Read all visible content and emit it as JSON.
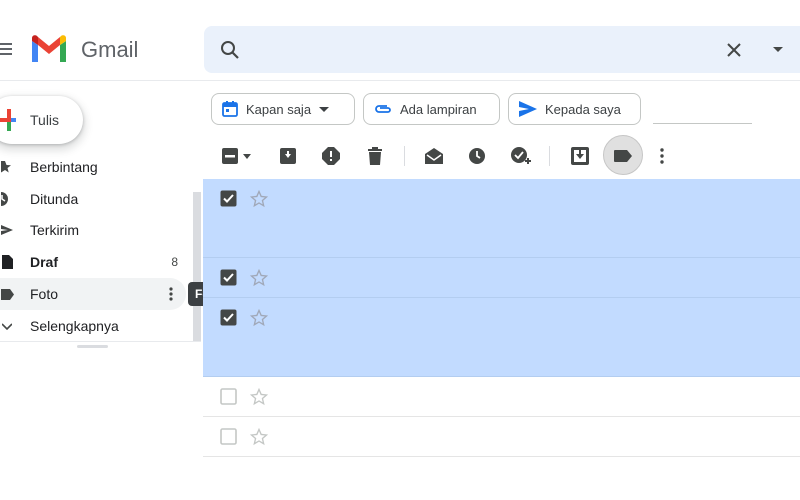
{
  "header": {
    "app_name": "Gmail",
    "search": {
      "value": "",
      "placeholder": ""
    },
    "icons": [
      "menu-icon",
      "gmail-logo",
      "search-icon",
      "close-icon",
      "dropdown-icon"
    ]
  },
  "compose": {
    "label": "Tulis"
  },
  "sidebar": {
    "items": [
      {
        "label": "Berbintang",
        "icon": "star-icon",
        "count": "",
        "bold": false,
        "active": false
      },
      {
        "label": "Ditunda",
        "icon": "clock-icon",
        "count": "",
        "bold": false,
        "active": false
      },
      {
        "label": "Terkirim",
        "icon": "send-icon",
        "count": "",
        "bold": false,
        "active": false
      },
      {
        "label": "Draf",
        "icon": "draft-icon",
        "count": "8",
        "bold": true,
        "active": false
      },
      {
        "label": "Foto",
        "icon": "label-icon",
        "count": "",
        "bold": false,
        "active": true
      },
      {
        "label": "Selengkapnya",
        "icon": "chevron-down-icon",
        "count": "",
        "bold": false,
        "active": false
      }
    ],
    "tooltip": "Foto"
  },
  "filters": {
    "chips": [
      {
        "label": "Kapan saja",
        "icon": "calendar-icon",
        "has_dropdown": true
      },
      {
        "label": "Ada lampiran",
        "icon": "attachment-icon",
        "has_dropdown": false
      },
      {
        "label": "Kepada saya",
        "icon": "send-arrow-icon",
        "has_dropdown": false
      }
    ]
  },
  "toolbar": {
    "buttons": [
      "select-all-checkbox",
      "select-dropdown",
      "archive",
      "report-spam",
      "delete",
      "mark-as-read",
      "snooze",
      "add-to-tasks",
      "move-to",
      "labels",
      "more-options"
    ],
    "active_button": "labels"
  },
  "messages": [
    {
      "selected": true,
      "starred": false
    },
    {
      "selected": true,
      "starred": false
    },
    {
      "selected": true,
      "starred": false
    },
    {
      "selected": false,
      "starred": false
    },
    {
      "selected": false,
      "starred": false
    }
  ],
  "colors": {
    "selected_row": "#c2dbff",
    "search_bg": "#eaf1fb",
    "accent_blue": "#1a73e8",
    "icon_gray": "#5f6368",
    "active_nav": "#f1f3f4"
  }
}
